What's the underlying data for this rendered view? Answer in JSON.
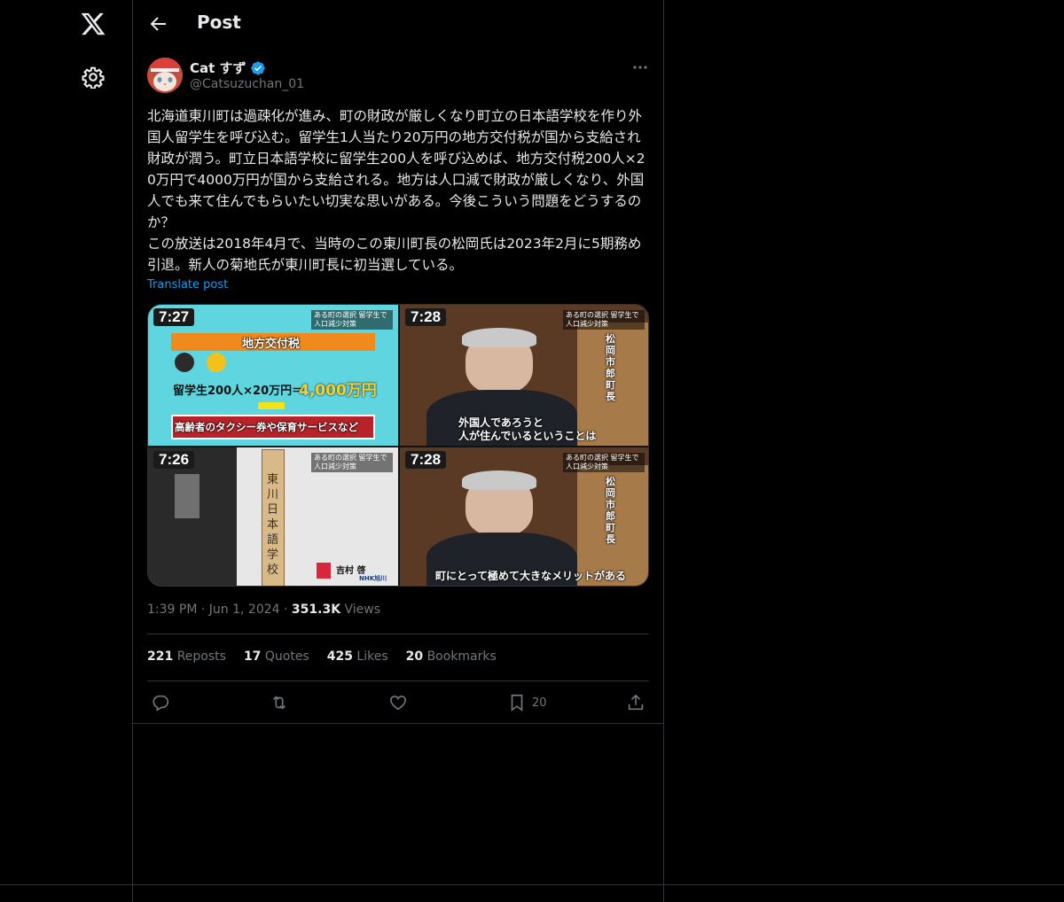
{
  "nav": {
    "logo_icon": "x-logo-icon",
    "settings_icon": "gear-icon"
  },
  "header": {
    "title": "Post",
    "back_icon": "arrow-left-icon"
  },
  "post": {
    "author_name": "Cat すず",
    "handle": "@Catsuzuchan_01",
    "verified": true,
    "text": "北海道東川町は過疎化が進み、町の財政が厳しくなり町立の日本語学校を作り外国人留学生を呼び込む。留学生1人当たり20万円の地方交付税が国から支給され財政が潤う。町立日本語学校に留学生200人を呼び込めば、地方交付税200人×20万円で4000万円が国から支給される。地方は人口減で財政が厳しくなり、外国人でも来て住んでもらいたい切実な思いがある。今後こういう問題をどうするのか？\nこの放送は2018年4月で、当時のこの東川町長の松岡氏は2023年2月に5期務め引退。新人の菊地氏が東川町長に初当選している。",
    "translate_label": "Translate post",
    "media": {
      "q1": {
        "time": "7:27",
        "headline": "地方交付税",
        "formula_left": "留学生200人×20万円＝",
        "formula_right": "4,000万円",
        "bottom": "高齢者のタクシー券や保育サービスなど",
        "banner": "ある町の選択 留学生で人口減少対策"
      },
      "q2": {
        "time": "7:28",
        "banner": "ある町の選択 留学生で人口減少対策",
        "caption": "外国人であろうと\n人が住んでいるということは",
        "side": "松岡市郎町長"
      },
      "q3": {
        "time": "7:26",
        "banner": "ある町の選択 留学生で人口減少対策",
        "sign": "東川日本語学校",
        "reporter": "吉村 啓",
        "reporter_org": "NHK旭川"
      },
      "q4": {
        "time": "7:28",
        "banner": "ある町の選択 留学生で人口減少対策",
        "caption": "町にとって極めて大きなメリットがある",
        "side": "松岡市郎町長"
      }
    },
    "time": "1:39 PM",
    "date": "Jun 1, 2024",
    "views_count": "351.3K",
    "views_label": "Views",
    "stats": {
      "reposts_count": "221",
      "reposts_label": "Reposts",
      "quotes_count": "17",
      "quotes_label": "Quotes",
      "likes_count": "425",
      "likes_label": "Likes",
      "bookmarks_count": "20",
      "bookmarks_label": "Bookmarks"
    },
    "actions": {
      "bookmark_count": "20"
    }
  },
  "colors": {
    "background": "#000000",
    "text": "#e7e9ea",
    "muted": "#71767b",
    "link": "#1d9bf0",
    "divider": "#2f3336"
  }
}
